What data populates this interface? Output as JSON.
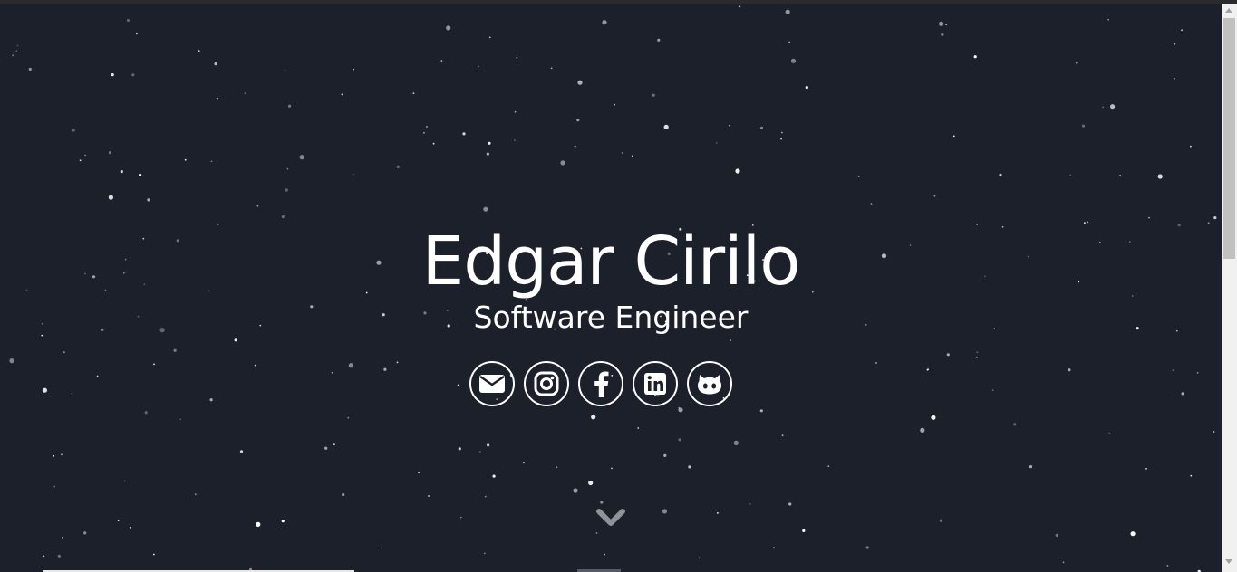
{
  "hero": {
    "name": "Edgar Cirilo",
    "role": "Software Engineer",
    "background_color": "#1c202b",
    "text_color": "#ffffff"
  },
  "socials": [
    {
      "icon": "email-icon"
    },
    {
      "icon": "instagram-icon"
    },
    {
      "icon": "facebook-icon"
    },
    {
      "icon": "linkedin-icon"
    },
    {
      "icon": "github-icon"
    }
  ],
  "scroll_indicator": {
    "icon": "chevron-down-icon"
  }
}
